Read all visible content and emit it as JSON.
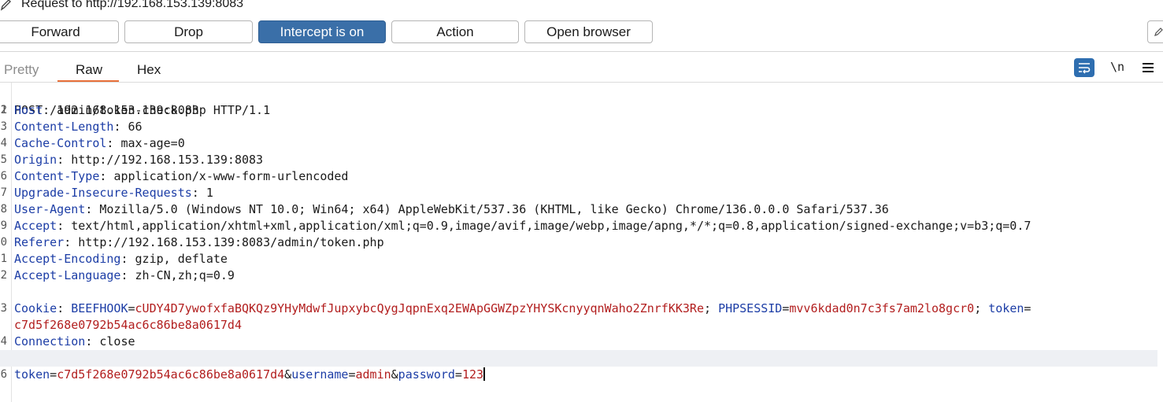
{
  "header": {
    "title": "Request to http://192.168.153.139:8083"
  },
  "toolbar": {
    "buttons": [
      {
        "label": "Forward"
      },
      {
        "label": "Drop"
      },
      {
        "label": "Intercept is on"
      },
      {
        "label": "Action"
      },
      {
        "label": "Open browser"
      }
    ]
  },
  "view_tabs": [
    {
      "label": "Pretty"
    },
    {
      "label": "Raw"
    },
    {
      "label": "Hex"
    }
  ],
  "view_icons": {
    "newline_label": "\\n"
  },
  "colors": {
    "accent": "#3a6fa8",
    "tab_underline": "#e8703a",
    "header_key": "#1c3da6",
    "cookie_value": "#b21e1e"
  },
  "request": {
    "request_line": "POST /admin/token-check.php HTTP/1.1",
    "headers": [
      {
        "line": "2",
        "key": "Host",
        "value": "192.168.153.139:8083"
      },
      {
        "line": "3",
        "key": "Content-Length",
        "value": "66"
      },
      {
        "line": "4",
        "key": "Cache-Control",
        "value": "max-age=0"
      },
      {
        "line": "5",
        "key": "Origin",
        "value": "http://192.168.153.139:8083"
      },
      {
        "line": "6",
        "key": "Content-Type",
        "value": "application/x-www-form-urlencoded"
      },
      {
        "line": "7",
        "key": "Upgrade-Insecure-Requests",
        "value": "1"
      },
      {
        "line": "8",
        "key": "User-Agent",
        "value": "Mozilla/5.0 (Windows NT 10.0; Win64; x64) AppleWebKit/537.36 (KHTML, like Gecko) Chrome/136.0.0.0 Safari/537.36"
      },
      {
        "line": "9",
        "key": "Accept",
        "value": "text/html,application/xhtml+xml,application/xml;q=0.9,image/avif,image/webp,image/apng,*/*;q=0.8,application/signed-exchange;v=b3;q=0.7"
      },
      {
        "line": "0",
        "key": "Referer",
        "value": "http://192.168.153.139:8083/admin/token.php"
      },
      {
        "line": "1",
        "key": "Accept-Encoding",
        "value": "gzip, deflate"
      },
      {
        "line": "2",
        "key": "Accept-Language",
        "value": "zh-CN,zh;q=0.9"
      }
    ],
    "cookie": {
      "line": "3",
      "key": "Cookie",
      "items": [
        {
          "name": "BEEFHOOK",
          "value": "cUDY4D7ywofxfaBQKQz9YHyMdwfJupxybcQygJqpnExq2EWApGGWZpzYHYSKcnyyqnWaho2ZnrfKK3Re"
        },
        {
          "name": "PHPSESSID",
          "value": "mvv6kdad0n7c3fs7am2lo8gcr0"
        },
        {
          "name": "token",
          "value": "c7d5f268e0792b54ac6c86be8a0617d4"
        }
      ]
    },
    "connection": {
      "line": "4",
      "key": "Connection",
      "value": "close"
    },
    "body": {
      "line": "6",
      "params": [
        {
          "name": "token",
          "value": "c7d5f268e0792b54ac6c86be8a0617d4"
        },
        {
          "name": "username",
          "value": "admin"
        },
        {
          "name": "password",
          "value": "123"
        }
      ]
    }
  }
}
